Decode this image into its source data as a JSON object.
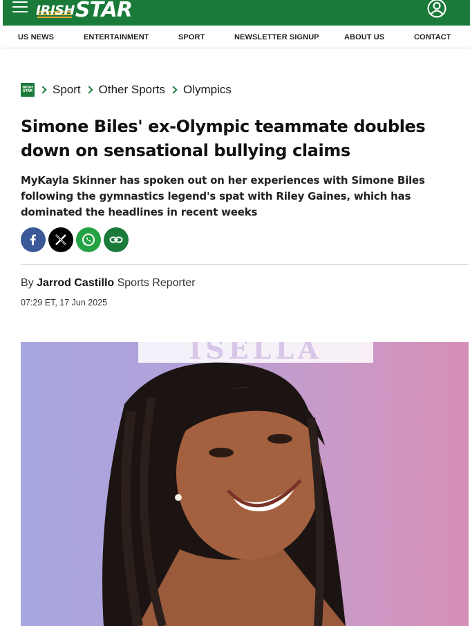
{
  "header": {
    "logo_irish": "IRISH",
    "logo_star": "STAR",
    "brand_color": "#1a7a3a"
  },
  "nav": {
    "items": [
      {
        "label": "US NEWS"
      },
      {
        "label": "ENTERTAINMENT"
      },
      {
        "label": "SPORT"
      },
      {
        "label": "NEWSLETTER SIGNUP"
      },
      {
        "label": "ABOUT US"
      },
      {
        "label": "CONTACT"
      }
    ]
  },
  "breadcrumb": {
    "items": [
      "Sport",
      "Other Sports",
      "Olympics"
    ]
  },
  "article": {
    "headline": "Simone Biles' ex-Olympic teammate doubles down on sensational bullying claims",
    "standfirst": "MyKayla Skinner has spoken out on her experiences with Simone Biles following the gymnastics legend's spat with Riley Gaines, which has dominated the headlines in recent weeks",
    "byline_prefix": "By",
    "author": "Jarrod Castillo",
    "author_role": "Sports Reporter",
    "timestamp": "07:29 ET, 17 Jun 2025",
    "hero_sign_text": "ISELLA"
  },
  "share": {
    "buttons": [
      {
        "icon": "facebook-icon",
        "color": "#3b5998"
      },
      {
        "icon": "x-icon",
        "color": "#000000"
      },
      {
        "icon": "whatsapp-icon",
        "color": "#25a244"
      },
      {
        "icon": "link-icon",
        "color": "#1a7a3a"
      }
    ]
  }
}
